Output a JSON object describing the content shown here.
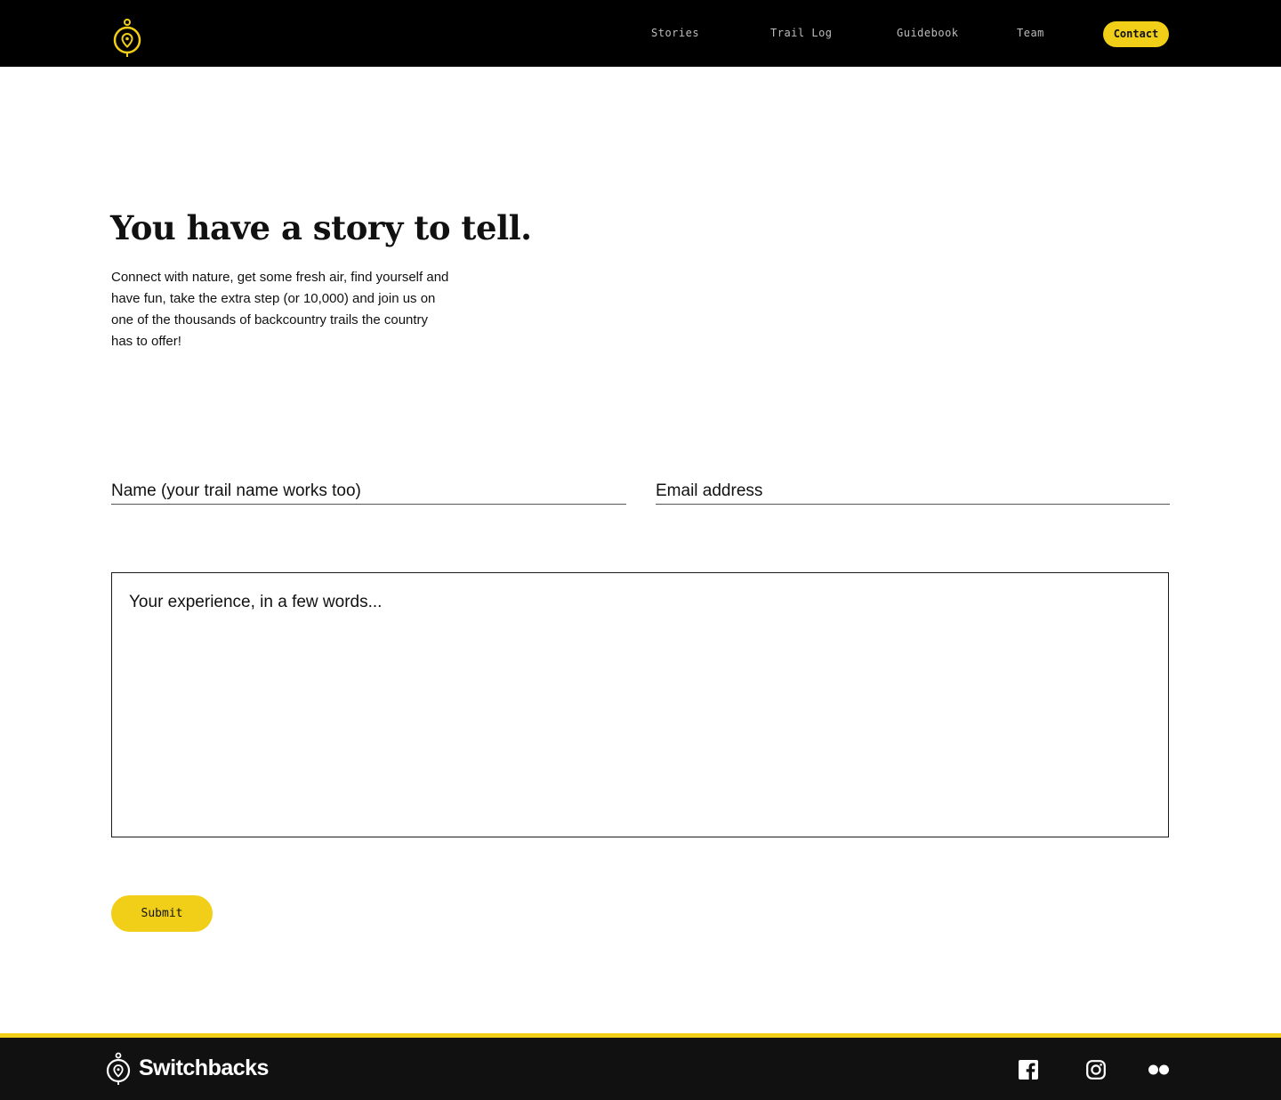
{
  "header": {
    "nav": [
      "Stories",
      "Trail Log",
      "Guidebook",
      "Team"
    ],
    "cta": "Contact"
  },
  "intro": {
    "title": "You have a story to tell.",
    "description": "Connect with nature, get some fresh air, find yourself and have fun, take the extra step (or 10,000) and join us on one of the thousands of backcountry trails the country has to offer!"
  },
  "form": {
    "name_placeholder": "Name (your trail name works too)",
    "name_value": "",
    "email_placeholder": "Email address",
    "email_value": "",
    "story_placeholder": "Your experience, in a few words...",
    "story_value": "",
    "submit_label": "Submit"
  },
  "footer": {
    "brand": "Switchbacks",
    "social": [
      "facebook-icon",
      "instagram-icon",
      "flickr-icon"
    ]
  },
  "colors": {
    "accent": "#f1ce18",
    "header_bg": "#000000",
    "footer_bg": "#111111",
    "text": "#111111"
  }
}
